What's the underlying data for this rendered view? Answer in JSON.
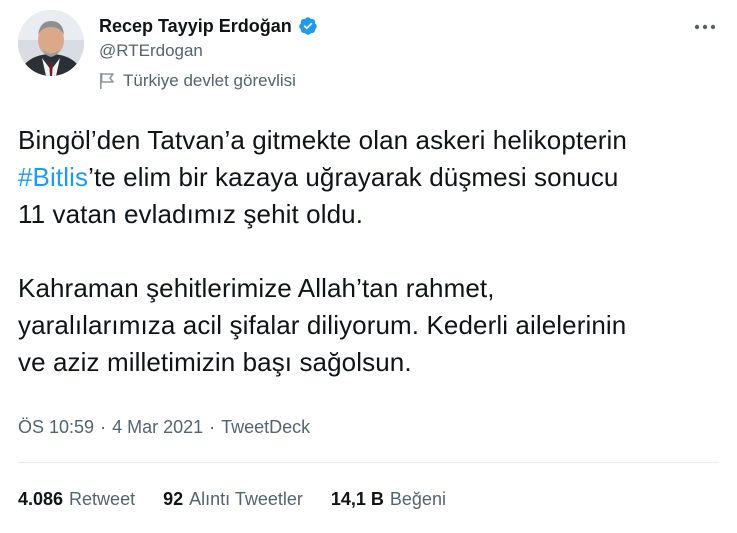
{
  "author": {
    "name": "Recep Tayyip Erdoğan",
    "handle": "@RTErdogan",
    "label": "Türkiye devlet görevlisi",
    "verified_color": "#1d9bf0"
  },
  "tweet": {
    "p1_l1": "Bingöl’den Tatvan’a gitmekte olan askeri helikopterin",
    "p1_hashtag": "#Bitlis",
    "p1_l2_rest": "’te elim bir kazaya uğrayarak düşmesi sonucu",
    "p1_l3": "11 vatan evladımız şehit oldu.",
    "p2_l1": "Kahraman şehitlerimize Allah’tan rahmet,",
    "p2_l2": "yaralılarımıza acil şifalar diliyorum. Kederli ailelerinin",
    "p2_l3": "ve aziz milletimizin başı sağolsun."
  },
  "meta": {
    "time": "ÖS 10:59",
    "sep1": "·",
    "date": "4 Mar 2021",
    "sep2": "·",
    "source": "TweetDeck"
  },
  "stats": {
    "retweets_num": "4.086",
    "retweets_label": "Retweet",
    "quotes_num": "92",
    "quotes_label": "Alıntı Tweetler",
    "likes_num": "14,1 B",
    "likes_label": "Beğeni"
  },
  "icons": {
    "more": "more-horizontal-icon",
    "verified": "verified-badge-icon",
    "label": "government-flag-icon"
  }
}
